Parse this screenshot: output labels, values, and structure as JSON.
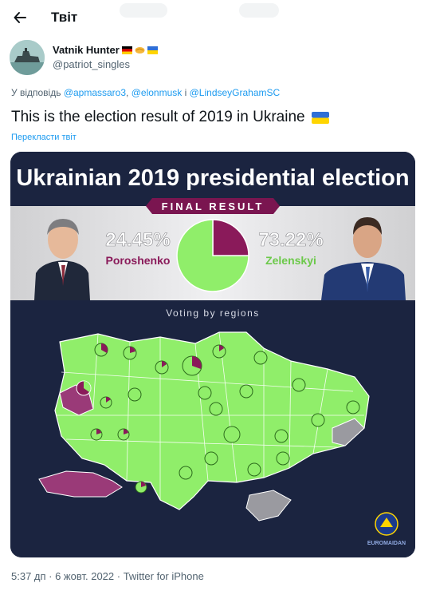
{
  "header": {
    "title": "Твіт",
    "back_icon": "arrow-left-icon"
  },
  "author": {
    "name": "Vatnik Hunter",
    "handle": "@patriot_singles",
    "emoji_flags": [
      "germany-flag",
      "handshake",
      "ukraine-flag"
    ]
  },
  "reply": {
    "prefix": "У відповідь",
    "user1": "@apmassaro3",
    "sep1": ",",
    "user2": "@elonmusk",
    "conj": "і",
    "user3": "@LindseyGrahamSC"
  },
  "tweet": {
    "text": "This is the election result of 2019 in Ukraine",
    "translate_label": "Перекласти твіт"
  },
  "infographic": {
    "headline": "Ukrainian 2019 presidential election",
    "banner": "FINAL RESULT",
    "left": {
      "percent": "24.45%",
      "name": "Poroshenko",
      "color": "#8a1a5a"
    },
    "right": {
      "percent": "73.22%",
      "name": "Zelenskyi",
      "color": "#90ee6a"
    },
    "regions_title": "Voting by regions",
    "logo_label": "EUROMAIDAN"
  },
  "chart_data": {
    "type": "pie",
    "title": "FINAL RESULT",
    "categories": [
      "Poroshenko",
      "Zelenskyi"
    ],
    "values": [
      24.45,
      73.22
    ],
    "colors": [
      "#8a1a5a",
      "#90ee6a"
    ]
  },
  "meta": {
    "text": "5:37 дп · 6 жовт. 2022 · Twitter for iPhone"
  }
}
